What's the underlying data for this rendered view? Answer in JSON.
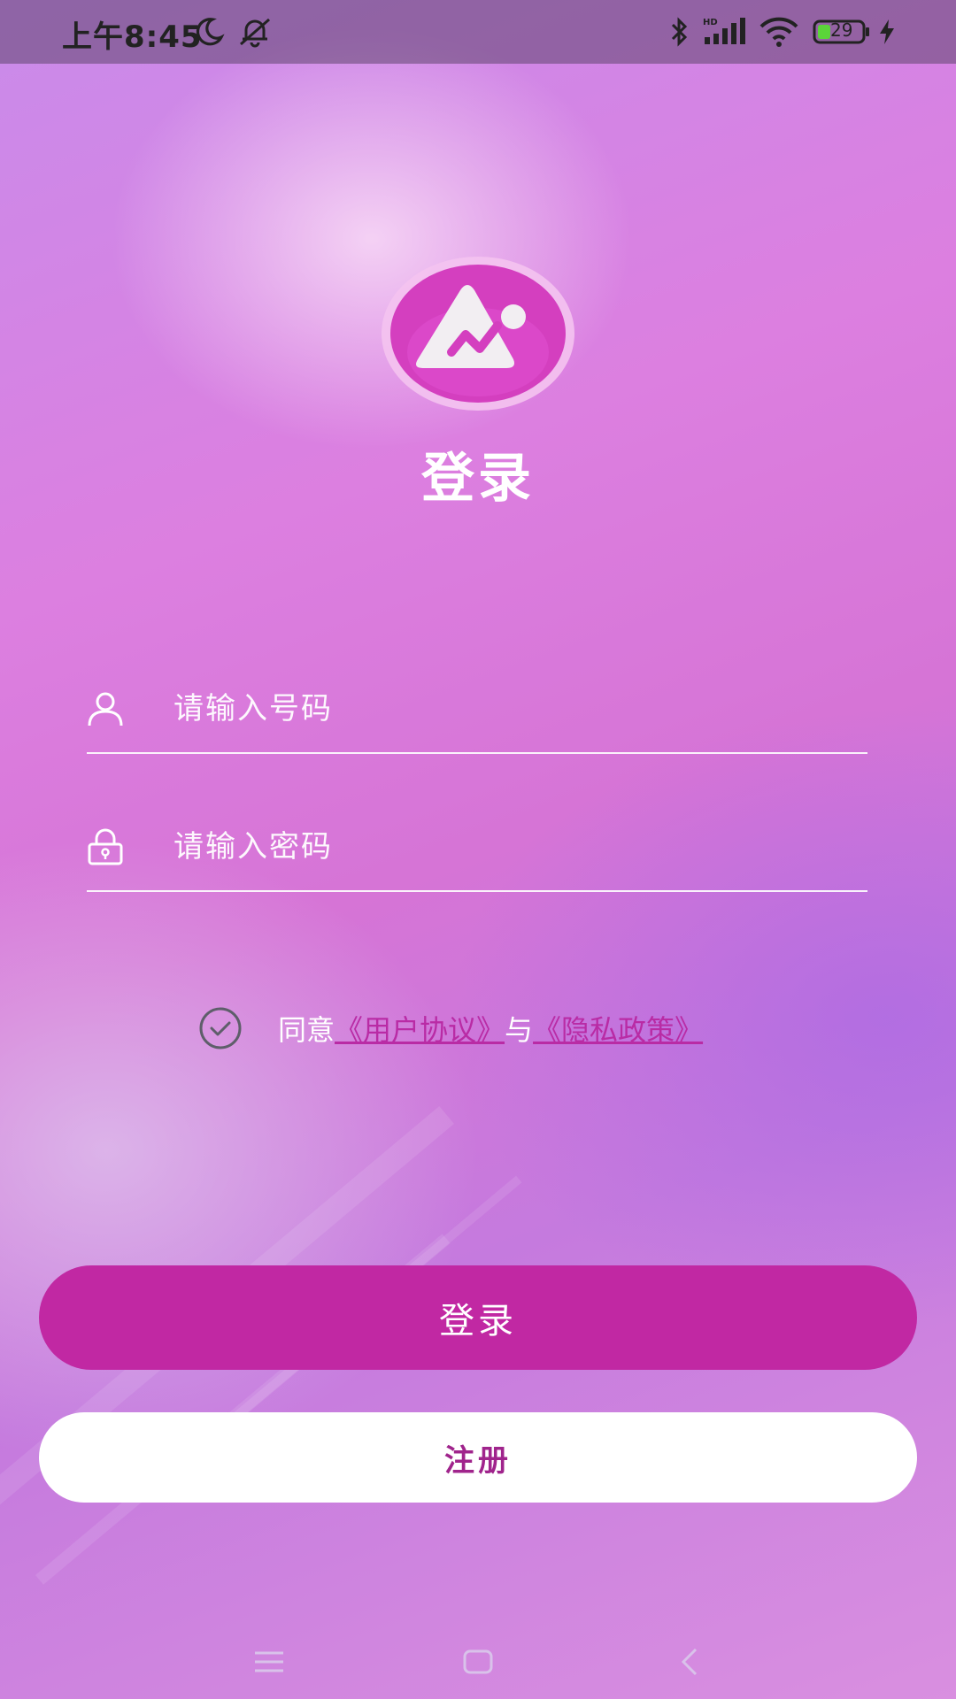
{
  "status_bar": {
    "time": "上午8:45",
    "battery_level": "29"
  },
  "page": {
    "title": "登录"
  },
  "form": {
    "phone_placeholder": "请输入号码",
    "password_placeholder": "请输入密码"
  },
  "agreement": {
    "prefix": "同意",
    "user_agreement": "《用户协议》",
    "conjunction": "与",
    "privacy_policy": "《隐私政策》"
  },
  "buttons": {
    "login": "登录",
    "register": "注册"
  },
  "icons": {
    "logo": "app-logo-icon",
    "user": "user-icon",
    "lock": "lock-icon",
    "check": "check-circle-icon"
  },
  "colors": {
    "accent": "#c128a3",
    "link": "#b92ba5",
    "register_text": "#a0248c"
  }
}
